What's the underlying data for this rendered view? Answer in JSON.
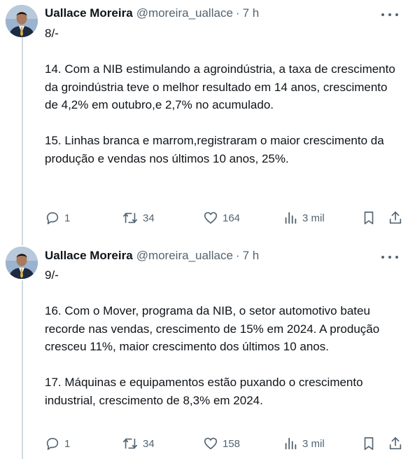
{
  "tweets": [
    {
      "name": "Uallace Moreira",
      "handle": "@moreira_uallace",
      "separator": "·",
      "time": "7 h",
      "text": "8/-\n\n14. Com a NIB estimulando a agroindústria, a taxa de crescimento da groindústria teve o melhor resultado em 14 anos, crescimento de 4,2% em outubro,e 2,7% no acumulado.\n\n15. Linhas branca e marrom,registraram o maior crescimento da produção e vendas nos últimos 10 anos, 25%.",
      "replies": "1",
      "retweets": "34",
      "likes": "164",
      "views": "3 mil"
    },
    {
      "name": "Uallace Moreira",
      "handle": "@moreira_uallace",
      "separator": "·",
      "time": "7 h",
      "text": "9/-\n\n16. Com o Mover, programa da NIB, o setor automotivo bateu recorde nas vendas, crescimento de 15% em 2024. A produção cresceu 11%, maior crescimento dos últimos 10 anos.\n\n17. Máquinas e equipamentos estão puxando o crescimento industrial, crescimento de 8,3% em 2024.",
      "replies": "1",
      "retweets": "34",
      "likes": "158",
      "views": "3 mil"
    }
  ],
  "icons": {
    "reply": "reply-icon",
    "retweet": "retweet-icon",
    "like": "heart-icon",
    "views": "views-icon",
    "bookmark": "bookmark-icon",
    "share": "share-icon",
    "more": "more-icon"
  },
  "colors": {
    "text": "#0f1419",
    "secondary": "#536471",
    "thread_line": "#cfd9de"
  }
}
